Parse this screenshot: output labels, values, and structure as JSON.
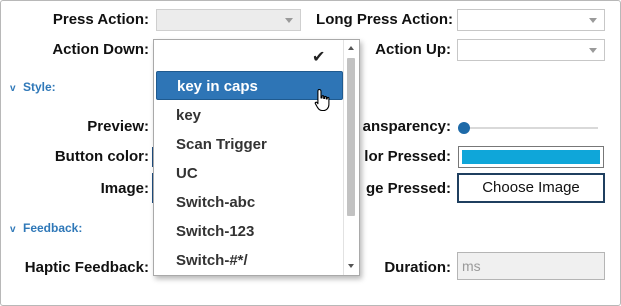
{
  "labels": {
    "press_action": "Press Action:",
    "long_press_action": "Long Press Action:",
    "action_down": "Action Down:",
    "action_up": "Action Up:",
    "preview": "Preview:",
    "transparency": "ansparency:",
    "button_color": "Button color:",
    "color_pressed": "lor Pressed:",
    "image": "Image:",
    "image_pressed": "ge Pressed:",
    "haptic_feedback": "Haptic Feedback:",
    "duration": "Duration:"
  },
  "sections": {
    "style": "Style:",
    "feedback": "Feedback:"
  },
  "icons": {
    "section_chevron": "v",
    "checkmark": "✔"
  },
  "buttons": {
    "choose_image": "Choose Image"
  },
  "duration_input": {
    "placeholder": "ms"
  },
  "colors": {
    "accent": "#2e75b6",
    "pressed_color": "#0fa6d9",
    "slider_thumb": "#1e6aa8"
  },
  "transparency_value": 0,
  "dropdown": {
    "items": [
      "key in caps",
      "key",
      "Scan Trigger",
      "UC",
      "Switch-abc",
      "Switch-123",
      "Switch-#*/"
    ],
    "highlighted_index": 0
  }
}
